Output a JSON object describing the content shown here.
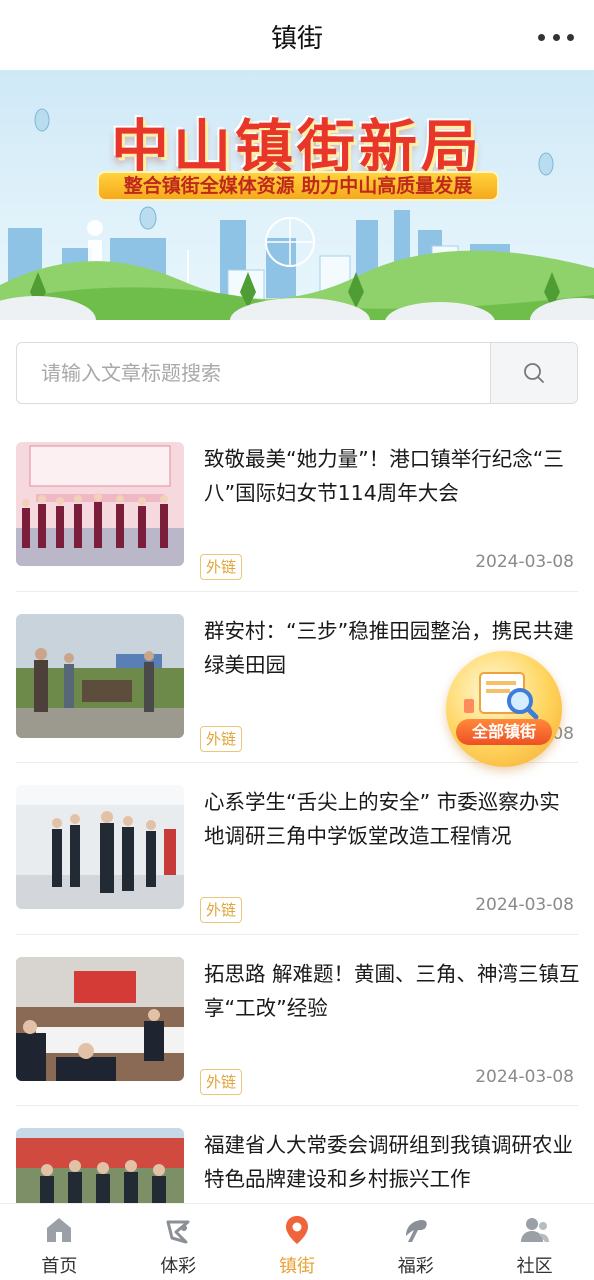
{
  "header": {
    "title": "镇街",
    "more_icon": "more-dots-icon"
  },
  "banner": {
    "title": "中山镇街新局",
    "subtitle": "整合镇街全媒体资源 助力中山高质量发展"
  },
  "search": {
    "placeholder": "请输入文章标题搜索",
    "value": "",
    "icon": "search-icon"
  },
  "articles": [
    {
      "title": "致敬最美“她力量”！港口镇举行纪念“三八”国际妇女节114周年大会",
      "tag": "外链",
      "date": "2024-03-08"
    },
    {
      "title": "群安村：“三步”稳推田园整治，携民共建绿美田园",
      "tag": "外链",
      "date": "2024-03-08"
    },
    {
      "title": "心系学生“舌尖上的安全” 市委巡察办实地调研三角中学饭堂改造工程情况",
      "tag": "外链",
      "date": "2024-03-08"
    },
    {
      "title": "拓思路 解难题！黄圃、三角、神湾三镇互享“工改”经验",
      "tag": "外链",
      "date": "2024-03-08"
    },
    {
      "title": "福建省人大常委会调研组到我镇调研农业特色品牌建设和乡村振兴工作",
      "tag": "",
      "date": ""
    }
  ],
  "float_badge": {
    "label": "全部镇街"
  },
  "tabs": [
    {
      "label": "首页",
      "icon": "home-icon"
    },
    {
      "label": "体彩",
      "icon": "sports-lottery-icon"
    },
    {
      "label": "镇街",
      "icon": "location-pin-icon",
      "active": true
    },
    {
      "label": "福彩",
      "icon": "welfare-lottery-icon"
    },
    {
      "label": "社区",
      "icon": "community-icon"
    }
  ],
  "colors": {
    "accent": "#e8a235",
    "tag": "#e0a43a",
    "banner_title": "#e8372a"
  }
}
